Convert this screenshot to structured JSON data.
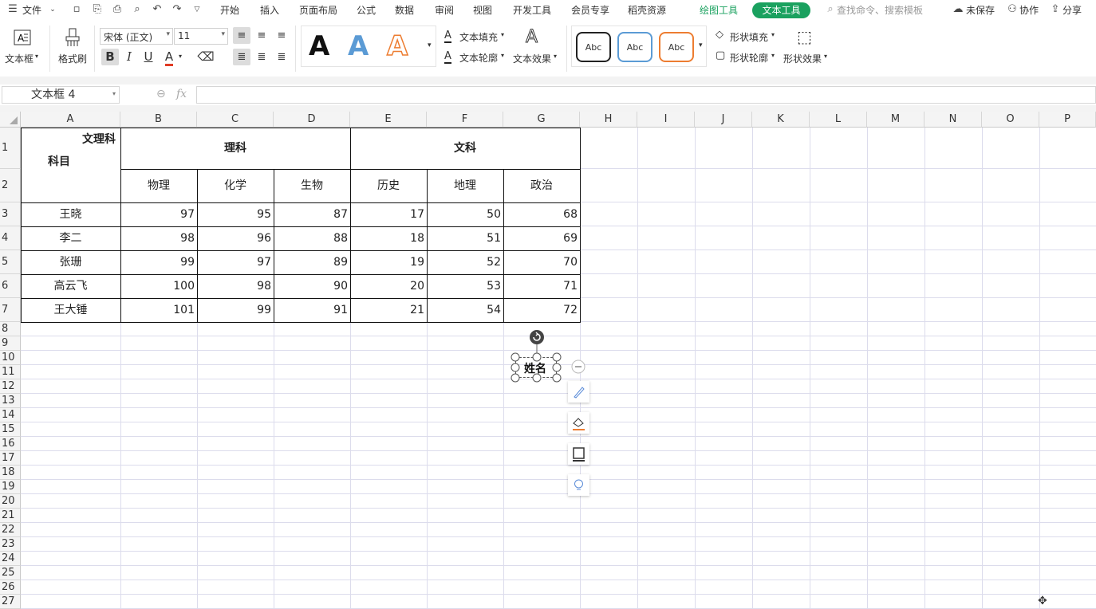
{
  "menubar": {
    "file_label": "文件",
    "tabs": [
      "开始",
      "插入",
      "页面布局",
      "公式",
      "数据",
      "审阅",
      "视图",
      "开发工具",
      "会员专享",
      "稻壳资源"
    ],
    "drawing_tools": "绘图工具",
    "text_tools": "文本工具",
    "search_placeholder": "查找命令、搜索模板",
    "unsaved": "未保存",
    "collab": "协作",
    "share": "分享"
  },
  "ribbon": {
    "textbox": "文本框",
    "format_painter": "格式刷",
    "font_name": "宋体 (正文)",
    "font_size": "11",
    "text_fill": "文本填充",
    "text_outline": "文本轮廓",
    "text_effect": "文本效果",
    "abc1": "Abc",
    "abc2": "Abc",
    "abc3": "Abc",
    "shape_fill": "形状填充",
    "shape_outline": "形状轮廓",
    "shape_effect": "形状效果"
  },
  "formula": {
    "namebox": "文本框 4",
    "fx": "fx"
  },
  "sheet": {
    "columns": [
      "A",
      "B",
      "C",
      "D",
      "E",
      "F",
      "G",
      "H",
      "I",
      "J",
      "K",
      "L",
      "M",
      "N",
      "O",
      "P"
    ],
    "rows": [
      "1",
      "2",
      "3",
      "4",
      "5",
      "6",
      "7",
      "8",
      "9",
      "10",
      "11",
      "12",
      "13",
      "14",
      "15",
      "16",
      "17",
      "18",
      "19",
      "20",
      "21",
      "22",
      "23",
      "24",
      "25",
      "26",
      "27"
    ],
    "header": {
      "corner_top": "文理科",
      "corner_bottom": "科目",
      "science": "理科",
      "arts": "文科",
      "subjects": [
        "物理",
        "化学",
        "生物",
        "历史",
        "地理",
        "政治"
      ]
    },
    "students": [
      {
        "name": "王晓",
        "scores": [
          "97",
          "95",
          "87",
          "17",
          "50",
          "68"
        ]
      },
      {
        "name": "李二",
        "scores": [
          "98",
          "96",
          "88",
          "18",
          "51",
          "69"
        ]
      },
      {
        "name": "张珊",
        "scores": [
          "99",
          "97",
          "89",
          "19",
          "52",
          "70"
        ]
      },
      {
        "name": "高云飞",
        "scores": [
          "100",
          "98",
          "90",
          "20",
          "53",
          "71"
        ]
      },
      {
        "name": "王大锤",
        "scores": [
          "101",
          "99",
          "91",
          "21",
          "54",
          "72"
        ]
      }
    ]
  },
  "textbox": {
    "text": "姓名"
  },
  "colors": {
    "accent": "#1aa15f",
    "grid": "#dcdcec"
  }
}
